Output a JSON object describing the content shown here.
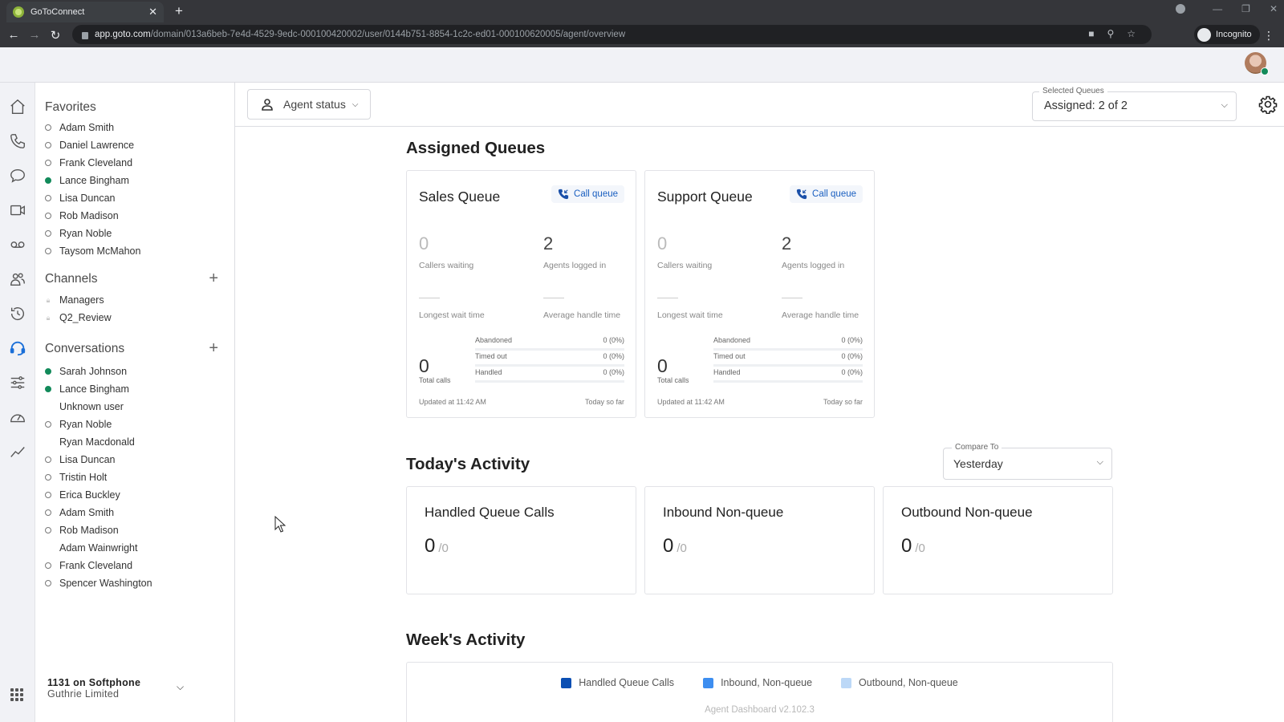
{
  "browser": {
    "tab_title": "GoToConnect",
    "url_host": "app.goto.com",
    "url_path": "/domain/013a6beb-7e4d-4529-9edc-000100420002/user/0144b751-8854-1c2c-ed01-000100620005/agent/overview",
    "incognito_label": "Incognito"
  },
  "rail": {
    "items": [
      "home",
      "phone",
      "chat",
      "video",
      "voicemail",
      "contacts",
      "history",
      "contact-center",
      "settings",
      "dashboard",
      "analytics"
    ],
    "active": "contact-center"
  },
  "sidebar": {
    "favorites": {
      "title": "Favorites",
      "items": [
        {
          "name": "Adam Smith",
          "status": "offline"
        },
        {
          "name": "Daniel Lawrence",
          "status": "offline"
        },
        {
          "name": "Frank Cleveland",
          "status": "offline"
        },
        {
          "name": "Lance Bingham",
          "status": "online"
        },
        {
          "name": "Lisa Duncan",
          "status": "offline"
        },
        {
          "name": "Rob Madison",
          "status": "offline"
        },
        {
          "name": "Ryan Noble",
          "status": "offline"
        },
        {
          "name": "Taysom McMahon",
          "status": "offline"
        }
      ]
    },
    "channels": {
      "title": "Channels",
      "items": [
        {
          "name": "Managers"
        },
        {
          "name": "Q2_Review"
        }
      ]
    },
    "conversations": {
      "title": "Conversations",
      "items": [
        {
          "name": "Sarah Johnson",
          "status": "online"
        },
        {
          "name": "Lance Bingham",
          "status": "online"
        },
        {
          "name": "Unknown user",
          "status": "none"
        },
        {
          "name": "Ryan Noble",
          "status": "offline"
        },
        {
          "name": "Ryan Macdonald",
          "status": "none"
        },
        {
          "name": "Lisa Duncan",
          "status": "offline"
        },
        {
          "name": "Tristin Holt",
          "status": "offline"
        },
        {
          "name": "Erica Buckley",
          "status": "offline"
        },
        {
          "name": "Adam Smith",
          "status": "offline"
        },
        {
          "name": "Rob Madison",
          "status": "offline"
        },
        {
          "name": "Adam Wainwright",
          "status": "none"
        },
        {
          "name": "Frank Cleveland",
          "status": "offline"
        },
        {
          "name": "Spencer Washington",
          "status": "offline"
        }
      ]
    },
    "line": {
      "title": "1131 on Softphone",
      "subtitle": "Guthrie Limited"
    }
  },
  "toolbar": {
    "agent_status_label": "Agent status",
    "selected_queues_label": "Selected Queues",
    "selected_queues_value": "Assigned: 2 of 2"
  },
  "assigned_queues": {
    "title": "Assigned Queues",
    "queues": [
      {
        "name": "Sales Queue",
        "badge": "Call queue",
        "callers_waiting": "0",
        "callers_waiting_label": "Callers waiting",
        "agents_logged_in": "2",
        "agents_logged_in_label": "Agents logged in",
        "longest_wait_label": "Longest wait time",
        "avg_handle_label": "Average handle time",
        "total_calls": "0",
        "total_calls_label": "Total calls",
        "breakdown": [
          {
            "label": "Abandoned",
            "value": "0 (0%)"
          },
          {
            "label": "Timed out",
            "value": "0 (0%)"
          },
          {
            "label": "Handled",
            "value": "0 (0%)"
          }
        ],
        "updated": "Updated at 11:42 AM",
        "period": "Today so far"
      },
      {
        "name": "Support Queue",
        "badge": "Call queue",
        "callers_waiting": "0",
        "callers_waiting_label": "Callers waiting",
        "agents_logged_in": "2",
        "agents_logged_in_label": "Agents logged in",
        "longest_wait_label": "Longest wait time",
        "avg_handle_label": "Average handle time",
        "total_calls": "0",
        "total_calls_label": "Total calls",
        "breakdown": [
          {
            "label": "Abandoned",
            "value": "0 (0%)"
          },
          {
            "label": "Timed out",
            "value": "0 (0%)"
          },
          {
            "label": "Handled",
            "value": "0 (0%)"
          }
        ],
        "updated": "Updated at 11:42 AM",
        "period": "Today so far"
      }
    ]
  },
  "todays_activity": {
    "title": "Today's Activity",
    "compare_label": "Compare To",
    "compare_value": "Yesterday",
    "cards": [
      {
        "title": "Handled Queue Calls",
        "value": "0",
        "compare": "/0"
      },
      {
        "title": "Inbound Non-queue",
        "value": "0",
        "compare": "/0"
      },
      {
        "title": "Outbound Non-queue",
        "value": "0",
        "compare": "/0"
      }
    ]
  },
  "weeks_activity": {
    "title": "Week's Activity",
    "legend": [
      {
        "label": "Handled Queue Calls",
        "color": "#0b4fb3"
      },
      {
        "label": "Inbound, Non-queue",
        "color": "#3d8ef0"
      },
      {
        "label": "Outbound, Non-queue",
        "color": "#bcd8f7"
      }
    ]
  },
  "footer": {
    "version": "Agent Dashboard v2.102.3"
  },
  "colors": {
    "accent": "#1a6fd8",
    "online": "#128a5a"
  }
}
